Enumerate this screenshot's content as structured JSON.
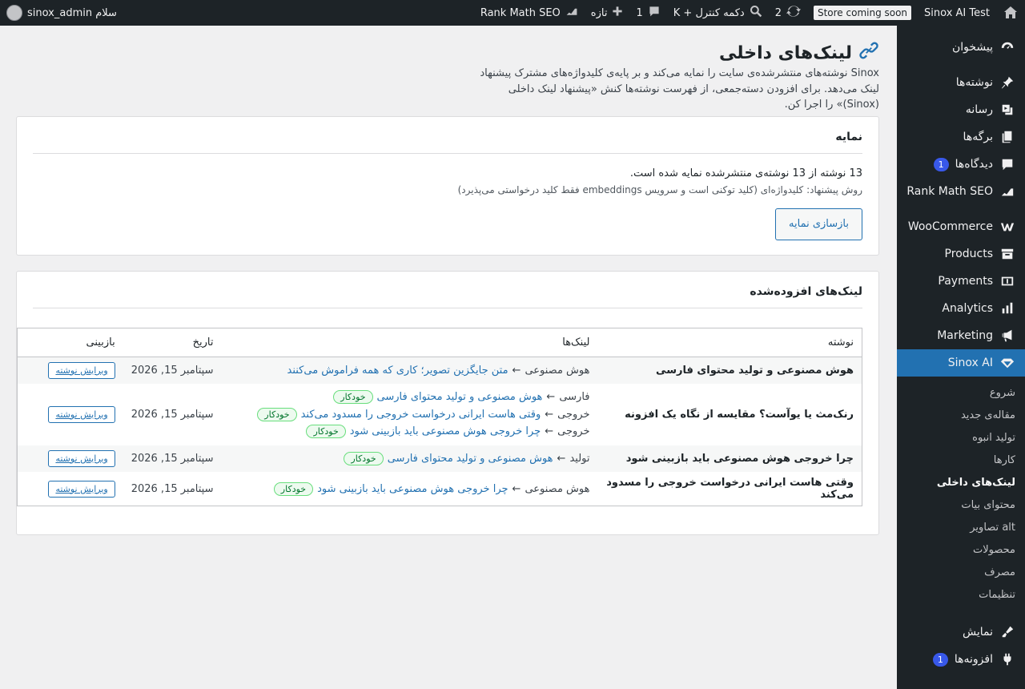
{
  "admin_bar": {
    "site_name": "Sinox AI Test",
    "store_badge": "Store coming soon",
    "updates_count": "2",
    "shortcut": "دکمه کنترل + K",
    "comments_count": "1",
    "new_label": "تازه",
    "rank_math": "Rank Math SEO",
    "greeting": "سلام sinox_admin"
  },
  "sidebar": {
    "dashboard": "پیشخوان",
    "posts": "نوشته‌ها",
    "media": "رسانه",
    "pages": "برگه‌ها",
    "comments": "دیدگاه‌ها",
    "comments_count": "1",
    "rank_math": "Rank Math SEO",
    "woocommerce": "WooCommerce",
    "products": "Products",
    "payments": "Payments",
    "analytics": "Analytics",
    "marketing": "Marketing",
    "sinox": "Sinox AI",
    "sub": [
      "شروع",
      "مقاله‌ی جدید",
      "تولید انبوه",
      "کارها",
      "لینک‌های داخلی",
      "محتوای بیات",
      "alt تصاویر",
      "محصولات",
      "مصرف",
      "تنظیمات"
    ],
    "appearance": "نمایش",
    "plugins": "افزونه‌ها",
    "plugins_count": "1"
  },
  "page": {
    "title": "لینک‌های داخلی",
    "description": "Sinox نوشته‌های منتشرشده‌ی سایت را نمایه می‌کند و بر پایه‌ی کلیدواژه‌های مشترک پیشنهاد لینک می‌دهد. برای افزودن دسته‌جمعی، از فهرست نوشته‌ها کنش «پیشنهاد لینک داخلی (Sinox)» را اجرا کن."
  },
  "index_card": {
    "title": "نمایه",
    "stat": "13 نوشته از 13 نوشته‌ی منتشرشده نمایه شده است.",
    "note": "روش پیشنهاد: کلیدواژه‌ای (کلید توکنی است و سرویس embeddings فقط کلید درخواستی می‌پذیرد)",
    "rebuild_button": "بازسازی نمایه"
  },
  "links_card": {
    "title": "لینک‌های افزوده‌شده",
    "columns": [
      "نوشته",
      "لینک‌ها",
      "تاریخ",
      "بازبینی"
    ],
    "rows": [
      {
        "post": "هوش مصنوعی و تولید محتوای فارسی",
        "links": [
          {
            "anchor": "هوش مصنوعی",
            "arrow": "←",
            "target": "متن جایگزین تصویر؛ کاری که همه فراموش می‌کنند",
            "badge": ""
          }
        ],
        "date": "سپتامبر 15, 2026",
        "action": "ویرایش نوشته"
      },
      {
        "post": "رنک‌مث یا یوآست؟ مقایسه از نگاه یک افزونه",
        "links": [
          {
            "anchor": "فارسی",
            "arrow": "←",
            "target": "هوش مصنوعی و تولید محتوای فارسی",
            "badge": "خودکار"
          },
          {
            "anchor": "خروجی",
            "arrow": "←",
            "target": "وقتی هاست ایرانی درخواست خروجی را مسدود می‌کند",
            "badge": "خودکار"
          },
          {
            "anchor": "خروجی",
            "arrow": "←",
            "target": "چرا خروجی هوش مصنوعی باید بازبینی شود",
            "badge": "خودکار"
          }
        ],
        "date": "سپتامبر 15, 2026",
        "action": "ویرایش نوشته"
      },
      {
        "post": "چرا خروجی هوش مصنوعی باید بازبینی شود",
        "links": [
          {
            "anchor": "تولید",
            "arrow": "←",
            "target": "هوش مصنوعی و تولید محتوای فارسی",
            "badge": "خودکار"
          }
        ],
        "date": "سپتامبر 15, 2026",
        "action": "ویرایش نوشته"
      },
      {
        "post": "وقتی هاست ایرانی درخواست خروجی را مسدود می‌کند",
        "links": [
          {
            "anchor": "هوش مصنوعی",
            "arrow": "←",
            "target": "چرا خروجی هوش مصنوعی باید بازبینی شود",
            "badge": "خودکار"
          }
        ],
        "date": "سپتامبر 15, 2026",
        "action": "ویرایش نوشته"
      }
    ]
  }
}
